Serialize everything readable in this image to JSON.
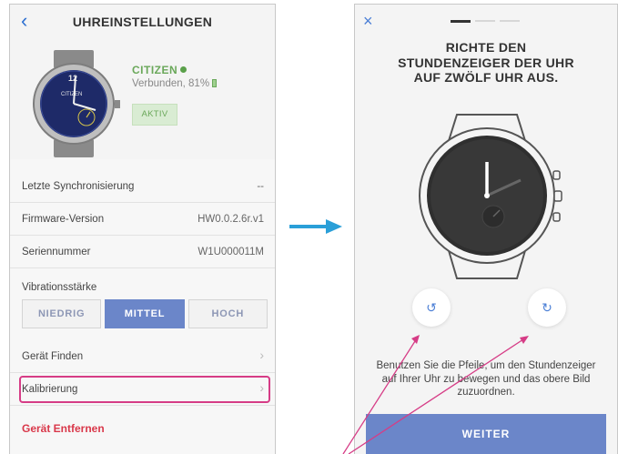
{
  "left_screen": {
    "back_glyph": "‹",
    "title": "UHREINSTELLUNGEN",
    "device": {
      "brand": "CITIZEN",
      "connection_text": "Verbunden, 81%",
      "battery_percent": 81,
      "status_badge": "AKTIV",
      "dial_numeral": "12",
      "dial_brand": "CITIZEN"
    },
    "rows": [
      {
        "label": "Letzte Synchronisierung",
        "value": "--"
      },
      {
        "label": "Firmware-Version",
        "value": "HW0.0.2.6r.v1"
      },
      {
        "label": "Seriennummer",
        "value": "W1U000011M"
      }
    ],
    "vibration": {
      "label": "Vibrationsstärke",
      "options": [
        "NIEDRIG",
        "MITTEL",
        "HOCH"
      ],
      "selected": "MITTEL"
    },
    "find_device": "Gerät Finden",
    "calibration": "Kalibrierung",
    "chevron": "›",
    "remove_device": "Gerät Entfernen"
  },
  "right_screen": {
    "close_glyph": "×",
    "step": {
      "current": 1,
      "total": 3
    },
    "title_lines": [
      "RICHTE DEN",
      "STUNDENZEIGER DER UHR",
      "AUF ZWÖLF UHR AUS."
    ],
    "counterclockwise_glyph": "↺",
    "clockwise_glyph": "↻",
    "help_lines": [
      "Benutzen Sie die Pfeile, um den Stundenzeiger",
      "auf Ihrer Uhr zu bewegen und das obere Bild",
      "zuzuordnen."
    ],
    "next_button": "WEITER"
  },
  "colors": {
    "accent_blue": "#6b86c9",
    "link_blue": "#4b7fd6",
    "brand_green": "#6aa85a",
    "danger_red": "#d9384a",
    "highlight_pink": "#d63c86",
    "arrow_blue": "#2a9fd8"
  }
}
